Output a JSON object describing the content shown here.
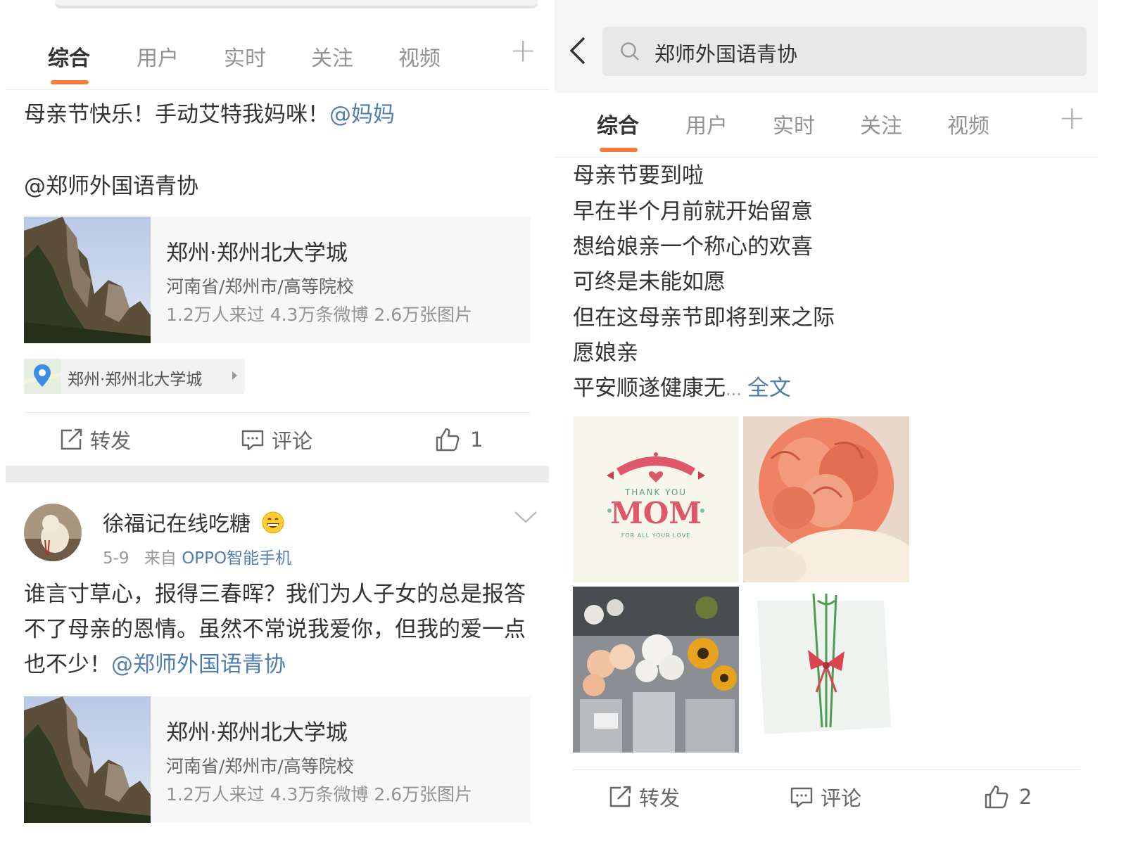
{
  "tabs": [
    "综合",
    "用户",
    "实时",
    "关注",
    "视频"
  ],
  "tabs_plus": "+",
  "left": {
    "post1": {
      "text": "母亲节快乐！手动艾特我妈咪！",
      "mention1": "@妈妈",
      "mention2": "@郑师外国语青协"
    },
    "location": {
      "name": "郑州·郑州北大学城",
      "address": "河南省/郑州市/高等院校",
      "stats": "1.2万人来过 4.3万条微博 2.6万张图片"
    },
    "location_chip": "郑州·郑州北大学城",
    "actions": {
      "repost": "转发",
      "comment": "评论",
      "like_count": "1"
    },
    "post2": {
      "username": "徐福记在线吃糖",
      "date": "5-9",
      "source_prefix": "来自",
      "device_brand": "OPPO",
      "device_suffix": "智能手机",
      "text": "谁言寸草心，报得三春晖？我们为人子女的总是报答不了母亲的恩情。虽然不常说我爱你，但我的爱一点也不少！",
      "mention": "@郑师外国语青协"
    },
    "location2": {
      "name": "郑州·郑州北大学城",
      "address": "河南省/郑州市/高等院校",
      "stats": "1.2万人来过 4.3万条微博 2.6万张图片"
    }
  },
  "right": {
    "search": {
      "query": "郑师外国语青协"
    },
    "poem": [
      "母亲节要到啦",
      "早在半个月前就开始留意",
      "想给娘亲一个称心的欢喜",
      "可终是未能如愿",
      "但在这母亲节即将到来之际",
      "愿娘亲"
    ],
    "poem_last": "平安顺遂健康无",
    "ellipsis": "...",
    "full_text_link": "全文",
    "card_images": {
      "thank_you": "THANK YOU",
      "mom": "MOM",
      "for_all": "FOR ALL YOUR LOVE"
    },
    "actions": {
      "repost": "转发",
      "comment": "评论",
      "like_count": "2"
    }
  },
  "colors": {
    "accent": "#fa7d3c",
    "link": "#507daf"
  }
}
